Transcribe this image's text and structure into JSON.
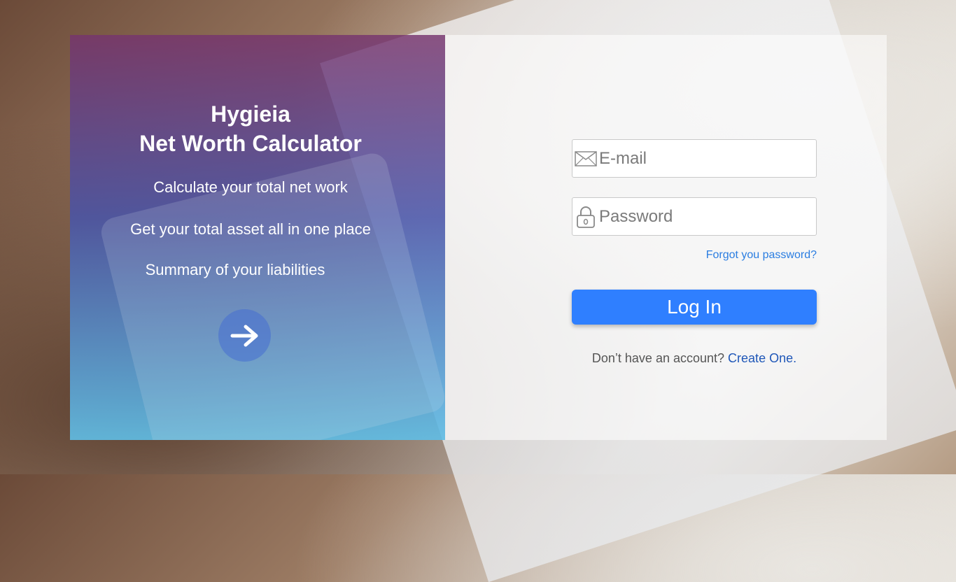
{
  "hero": {
    "title_line1": "Hygieia",
    "title_line2": "Net Worth Calculator",
    "features": [
      "Calculate your total net work",
      "Get your total asset all in one place",
      "Summary of your liabilities"
    ],
    "arrow_icon": "arrow-right-icon"
  },
  "login": {
    "email_placeholder": "E-mail",
    "email_value": "",
    "email_icon": "envelope-icon",
    "password_placeholder": "Password",
    "password_value": "",
    "password_icon": "lock-icon",
    "forgot_label": "Forgot you password?",
    "login_label": "Log In",
    "signup_prompt": "Don’t have an account?",
    "signup_link": "Create One."
  },
  "colors": {
    "primary_button": "#2f7fff",
    "link": "#2a7de1",
    "signup_link": "#1f57b8",
    "hero_gradient_top": "#76346e",
    "hero_gradient_bottom": "#60bee6"
  }
}
